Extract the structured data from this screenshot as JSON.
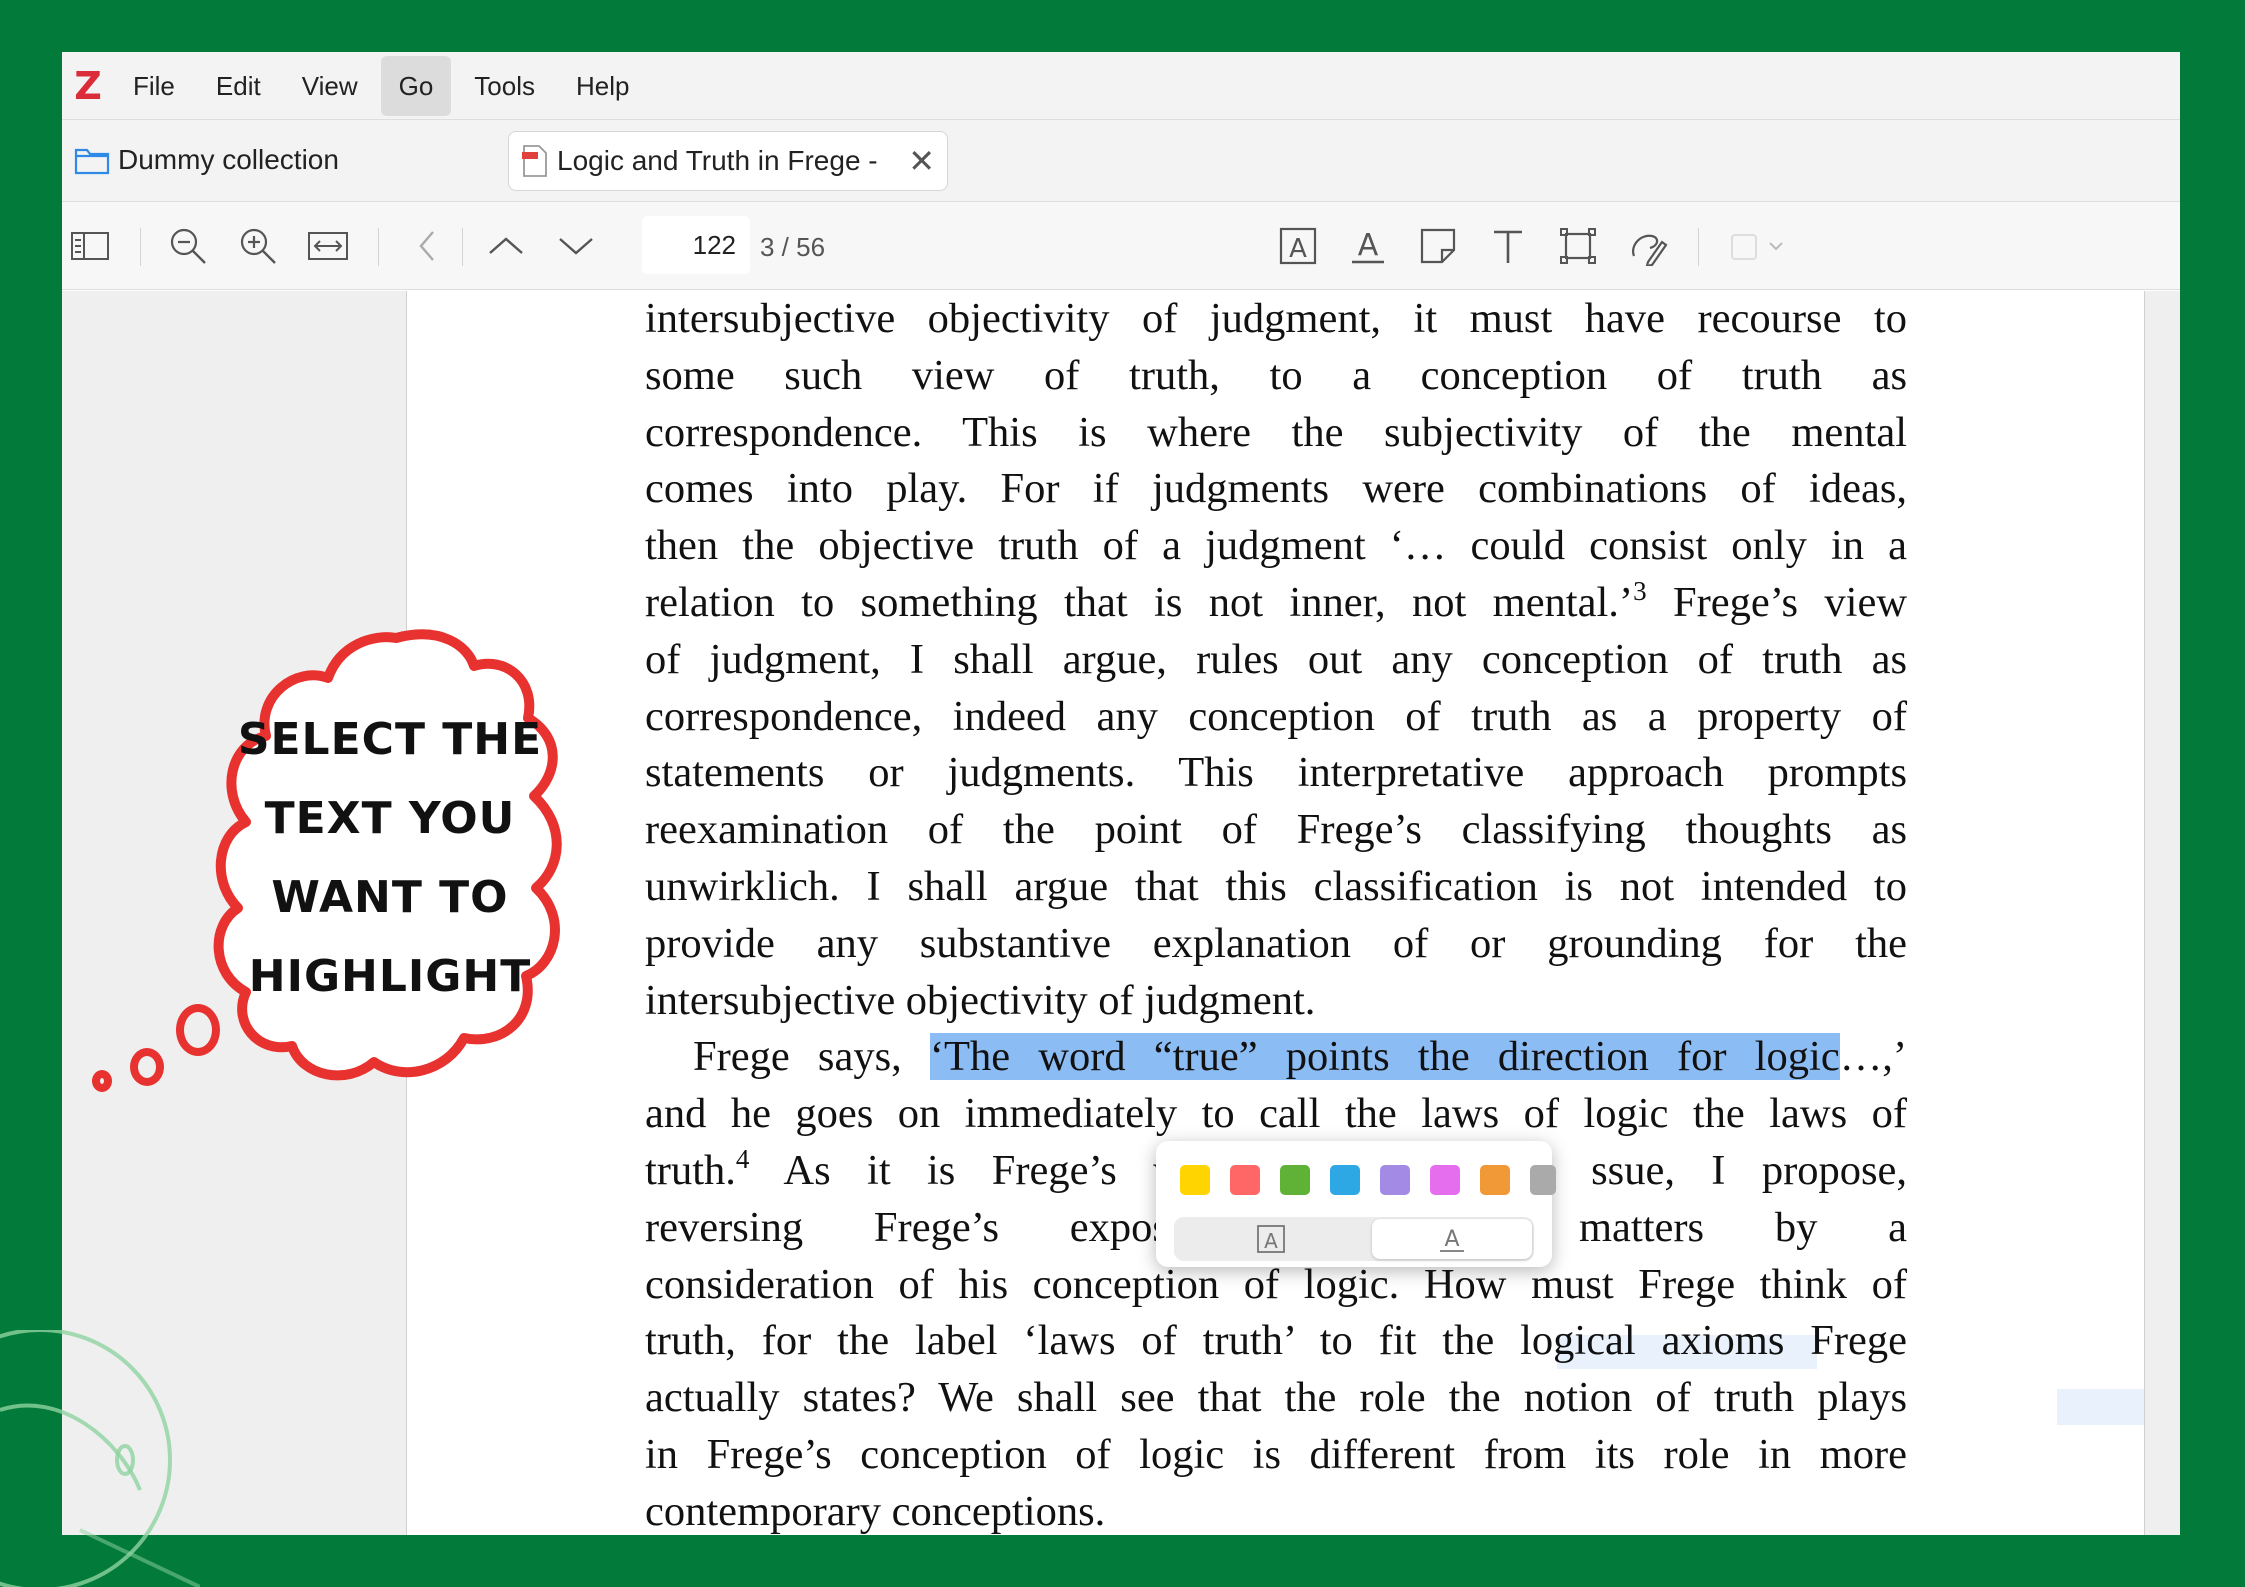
{
  "app": {
    "logo": "Z",
    "menu": [
      "File",
      "Edit",
      "View",
      "Go",
      "Tools",
      "Help"
    ],
    "active_menu": "Go"
  },
  "tabs": {
    "library_label": "Dummy collection",
    "document_label": "Logic and Truth in Frege -"
  },
  "toolbar": {
    "page_number": "122",
    "page_count": "3 / 56"
  },
  "document": {
    "lines": [
      "intersubjective objectivity of judgment, it must have recourse to",
      "some such view of truth, to a conception of truth as",
      "correspondence. This is where the subjectivity of the mental",
      "comes into play. For if judgments were combinations of ideas,",
      "then the objective truth of a judgment ‘… could consist only in a",
      "relation to something that is not inner, not mental.’",
      "Frege’s view",
      "of judgment, I shall argue, rules out any conception of truth as",
      "correspondence, indeed any conception of truth as a property of",
      "statements or judgments. This interpretative approach prompts",
      "reexamination of the point of Frege’s classifying thoughts as",
      "unwirklich. I shall argue that this classification is not intended to",
      "provide any substantive explanation of or grounding for the",
      "intersubjective objectivity of judgment.",
      "Frege says, ",
      "‘The word “true” points the direction for logic",
      "…,’",
      "and he goes on immediately to call the laws of logic the laws of",
      "truth.",
      " As it is Frege’s vie",
      "ssue, I propose,",
      "reversing Frege’s expos",
      "matters by a",
      "consideration of his conception of logic. How must Frege think of",
      "truth, for the label ‘laws of truth’ to fit the logical axioms Frege",
      "actually states? We shall see that the role the notion of truth plays",
      "in Frege’s conception of logic is different from its role in more",
      "contemporary conceptions."
    ],
    "footnote_3": "3",
    "footnote_4": "4",
    "highlight_color": "#8cbcf4"
  },
  "popup": {
    "colors": [
      "#ffd400",
      "#ff6666",
      "#5fb236",
      "#2ea8e5",
      "#a28ae5",
      "#e56eee",
      "#f19837",
      "#aaaaaa"
    ],
    "color_names": [
      "yellow",
      "red",
      "green",
      "blue",
      "purple",
      "magenta",
      "orange",
      "gray"
    ],
    "mode_highlight_icon": "A",
    "mode_underline_icon": "A",
    "selected_mode": "underline"
  },
  "callout": {
    "lines": [
      "SELECT THE",
      "TEXT YOU",
      "WANT TO",
      "HIGHLIGHT"
    ],
    "accent_color": "#e8322f"
  },
  "colors": {
    "background": "#027a3a",
    "toolbar": "#f7f7f7"
  }
}
